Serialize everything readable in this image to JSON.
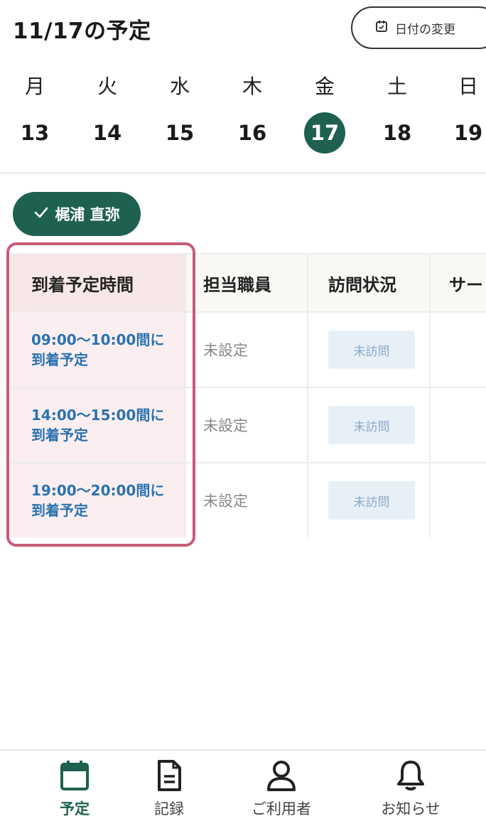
{
  "header": {
    "title": "11/17の予定",
    "change_date_label": "日付の変更"
  },
  "week": [
    {
      "name": "月",
      "num": "13",
      "selected": false
    },
    {
      "name": "火",
      "num": "14",
      "selected": false
    },
    {
      "name": "水",
      "num": "15",
      "selected": false
    },
    {
      "name": "木",
      "num": "16",
      "selected": false
    },
    {
      "name": "金",
      "num": "17",
      "selected": true
    },
    {
      "name": "土",
      "num": "18",
      "selected": false
    },
    {
      "name": "日",
      "num": "19",
      "selected": false
    }
  ],
  "staff_filter": {
    "label": "梶浦 直弥"
  },
  "table": {
    "headers": [
      "到着予定時間",
      "担当職員",
      "訪問状況",
      "サー"
    ],
    "rows": [
      {
        "time_line1": "09:00〜10:00間に",
        "time_line2": "到着予定",
        "staff": "未設定",
        "status": "未訪問"
      },
      {
        "time_line1": "14:00〜15:00間に",
        "time_line2": "到着予定",
        "staff": "未設定",
        "status": "未訪問"
      },
      {
        "time_line1": "19:00〜20:00間に",
        "time_line2": "到着予定",
        "staff": "未設定",
        "status": "未訪問"
      }
    ]
  },
  "bottom_nav": [
    {
      "label": "予定",
      "icon": "calendar-icon",
      "active": true
    },
    {
      "label": "記録",
      "icon": "document-icon",
      "active": false
    },
    {
      "label": "ご利用者",
      "icon": "person-icon",
      "active": false
    },
    {
      "label": "お知らせ",
      "icon": "bell-icon",
      "active": false
    }
  ],
  "colors": {
    "accent": "#1e6150",
    "highlight": "#c95a78",
    "time_text": "#2b73b0"
  }
}
